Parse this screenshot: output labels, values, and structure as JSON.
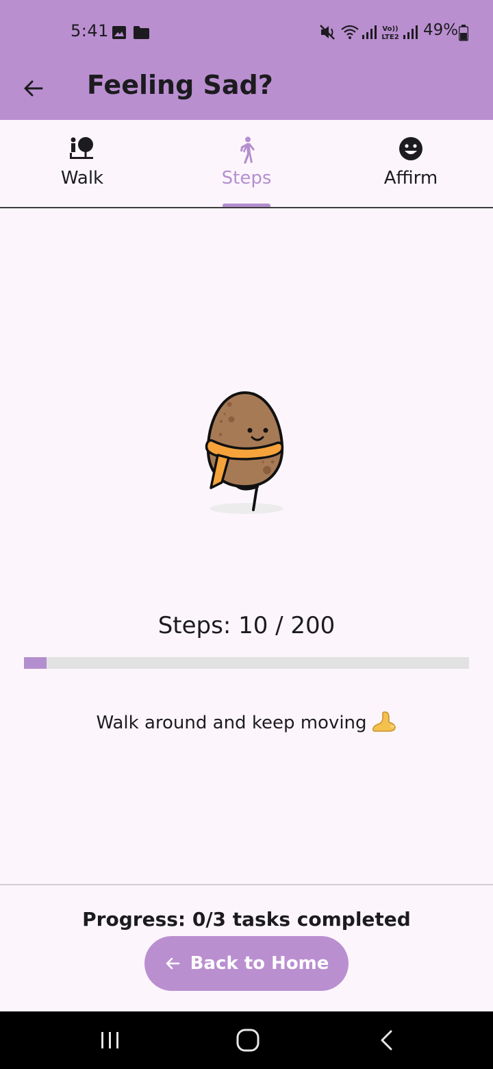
{
  "status_bar": {
    "time": "5:41",
    "battery": "49%",
    "icons": [
      "gallery-icon",
      "folder-icon",
      "mute-icon",
      "wifi-icon",
      "signal-icon",
      "volte-icon",
      "signal-icon",
      "battery-icon"
    ]
  },
  "app_bar": {
    "title": "Feeling Sad?",
    "back_icon": "arrow-left-icon"
  },
  "tabs": [
    {
      "label": "Walk",
      "icon": "park-icon",
      "active": false
    },
    {
      "label": "Steps",
      "icon": "walking-person-icon",
      "active": true
    },
    {
      "label": "Affirm",
      "icon": "smiley-icon",
      "active": false
    }
  ],
  "steps": {
    "text": "Steps: 10 / 200",
    "current": 10,
    "goal": 200,
    "progress_fraction": 0.05
  },
  "message": {
    "text": "Walk around and keep moving",
    "emoji": "foot-emoji"
  },
  "footer": {
    "progress_text": "Progress: 0/3 tasks completed",
    "home_button_label": "Back to Home",
    "home_button_icon": "arrow-left-icon"
  },
  "colors": {
    "accent": "#ba8fd0",
    "accent_text": "#b48fcf",
    "background": "#fcf6fc"
  },
  "nav_bar": {
    "buttons": [
      "recent-apps-icon",
      "home-icon",
      "back-chevron-icon"
    ]
  }
}
